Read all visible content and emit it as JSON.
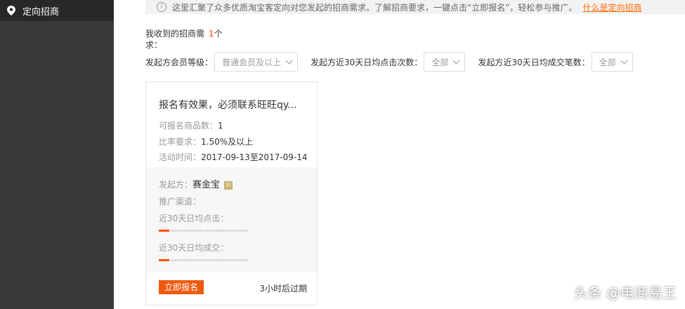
{
  "sidebar": {
    "item_label": "定向招商"
  },
  "notice": {
    "text": "这里汇聚了众多优质淘宝客定向对您发起的招商需求。了解招商要求，一键点击“立即报名”，轻松参与推广。",
    "link": "什么是定向招商"
  },
  "received": {
    "prefix": "我收到的招商需",
    "count": "1",
    "unit": "个",
    "tail": "求："
  },
  "filters": {
    "level_label": "发起方会员等级：",
    "level_value": "普通会员及以上",
    "clicks_label": "发起方近30天日均点击次数：",
    "clicks_value": "全部",
    "deals_label": "发起方近30天日均成交笔数：",
    "deals_value": "全部"
  },
  "card": {
    "title": "报名有效果，必须联系旺旺qy...",
    "goods_label": "可报名商品数：",
    "goods_value": "1",
    "rate_label": "比率要求：",
    "rate_value": "1.50%及以上",
    "time_label": "活动时间：",
    "time_value": "2017-09-13至2017-09-14",
    "sponsor_label": "发起方：",
    "sponsor_value": "赛金宝",
    "sponsor_tag": "XI",
    "channel_label": "推广渠道：",
    "clicks_label": "近30天日均点击：",
    "clicks_level": 1,
    "deals_label": "近30天日均成交：",
    "deals_level": 1,
    "signup_button": "立即报名",
    "expire_text": "3小时后过期"
  },
  "watermark": "头条 @电商易王",
  "colors": {
    "accent": "#ff6a00",
    "button": "#f05a0e",
    "sidebar": "#3c3a39"
  }
}
